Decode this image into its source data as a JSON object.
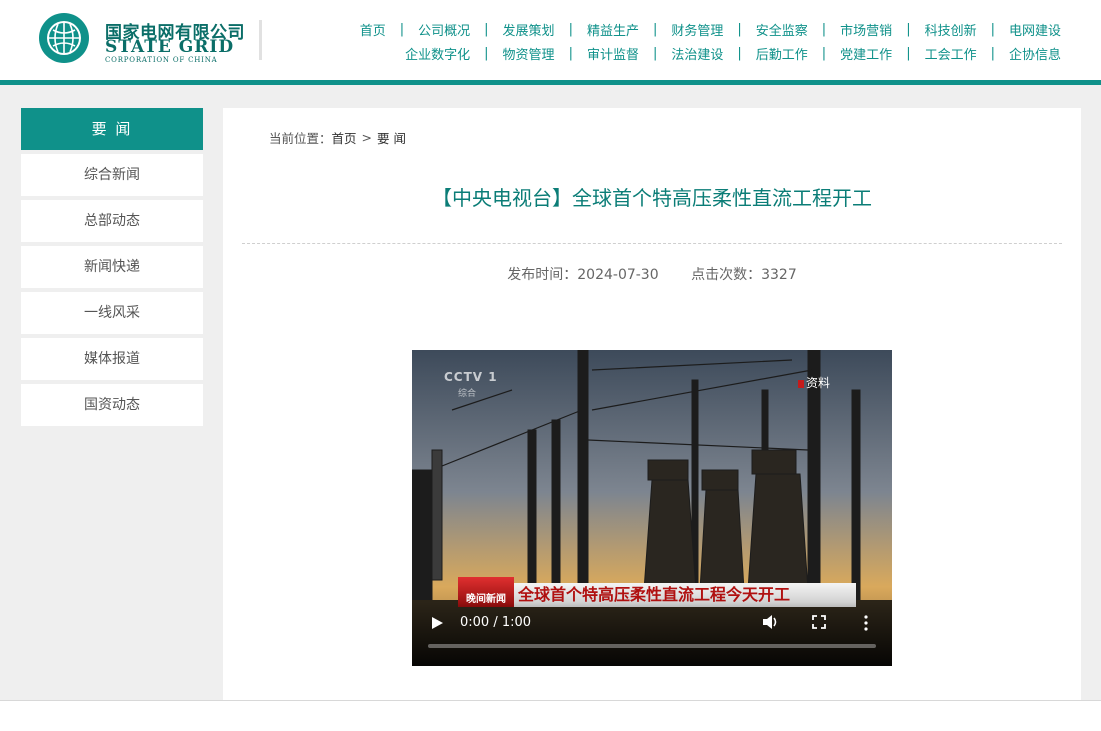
{
  "brand": {
    "name_cn": "国家电网有限公司",
    "name_en": "STATE GRID",
    "name_en_sub": "CORPORATION OF CHINA",
    "accent": "#0f918a"
  },
  "nav": {
    "row1": [
      "首页",
      "公司概况",
      "发展策划",
      "精益生产",
      "财务管理",
      "安全监察",
      "市场营销",
      "科技创新",
      "电网建设"
    ],
    "row2": [
      "企业数字化",
      "物资管理",
      "审计监督",
      "法治建设",
      "后勤工作",
      "党建工作",
      "工会工作",
      "企协信息"
    ],
    "separator": "|"
  },
  "sidebar": {
    "title": "要 闻",
    "items": [
      "综合新闻",
      "总部动态",
      "新闻快递",
      "一线风采",
      "媒体报道",
      "国资动态"
    ]
  },
  "breadcrumb": {
    "label": "当前位置：",
    "home": "首页",
    "arrow": ">",
    "current": "要 闻"
  },
  "article": {
    "title": "【中央电视台】全球首个特高压柔性直流工程开工",
    "publish_time": "发布时间：2024-07-30",
    "views": "点击次数：3327"
  },
  "video": {
    "channel_logo": "CCTV 1",
    "channel_sub": "综合",
    "badge": "资料",
    "caption_tag": "晚间新闻",
    "caption": "全球首个特高压柔性直流工程今天开工",
    "time": "0:00 / 1:00",
    "progress": 0,
    "icons": [
      "play-icon",
      "volume-icon",
      "fullscreen-icon",
      "more-options-icon"
    ]
  }
}
